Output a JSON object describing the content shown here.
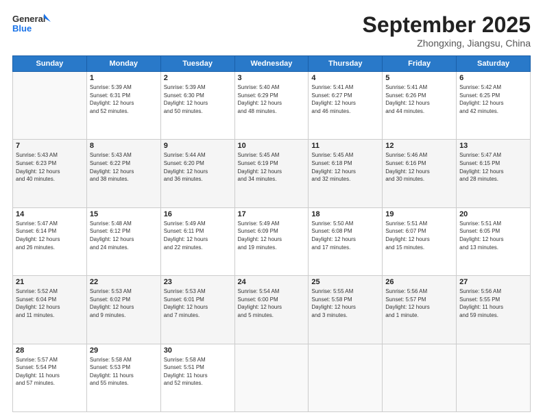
{
  "header": {
    "logo_line1": "General",
    "logo_line2": "Blue",
    "month": "September 2025",
    "location": "Zhongxing, Jiangsu, China"
  },
  "columns": [
    "Sunday",
    "Monday",
    "Tuesday",
    "Wednesday",
    "Thursday",
    "Friday",
    "Saturday"
  ],
  "weeks": [
    [
      {
        "day": "",
        "info": ""
      },
      {
        "day": "1",
        "info": "Sunrise: 5:39 AM\nSunset: 6:31 PM\nDaylight: 12 hours\nand 52 minutes."
      },
      {
        "day": "2",
        "info": "Sunrise: 5:39 AM\nSunset: 6:30 PM\nDaylight: 12 hours\nand 50 minutes."
      },
      {
        "day": "3",
        "info": "Sunrise: 5:40 AM\nSunset: 6:29 PM\nDaylight: 12 hours\nand 48 minutes."
      },
      {
        "day": "4",
        "info": "Sunrise: 5:41 AM\nSunset: 6:27 PM\nDaylight: 12 hours\nand 46 minutes."
      },
      {
        "day": "5",
        "info": "Sunrise: 5:41 AM\nSunset: 6:26 PM\nDaylight: 12 hours\nand 44 minutes."
      },
      {
        "day": "6",
        "info": "Sunrise: 5:42 AM\nSunset: 6:25 PM\nDaylight: 12 hours\nand 42 minutes."
      }
    ],
    [
      {
        "day": "7",
        "info": "Sunrise: 5:43 AM\nSunset: 6:23 PM\nDaylight: 12 hours\nand 40 minutes."
      },
      {
        "day": "8",
        "info": "Sunrise: 5:43 AM\nSunset: 6:22 PM\nDaylight: 12 hours\nand 38 minutes."
      },
      {
        "day": "9",
        "info": "Sunrise: 5:44 AM\nSunset: 6:20 PM\nDaylight: 12 hours\nand 36 minutes."
      },
      {
        "day": "10",
        "info": "Sunrise: 5:45 AM\nSunset: 6:19 PM\nDaylight: 12 hours\nand 34 minutes."
      },
      {
        "day": "11",
        "info": "Sunrise: 5:45 AM\nSunset: 6:18 PM\nDaylight: 12 hours\nand 32 minutes."
      },
      {
        "day": "12",
        "info": "Sunrise: 5:46 AM\nSunset: 6:16 PM\nDaylight: 12 hours\nand 30 minutes."
      },
      {
        "day": "13",
        "info": "Sunrise: 5:47 AM\nSunset: 6:15 PM\nDaylight: 12 hours\nand 28 minutes."
      }
    ],
    [
      {
        "day": "14",
        "info": "Sunrise: 5:47 AM\nSunset: 6:14 PM\nDaylight: 12 hours\nand 26 minutes."
      },
      {
        "day": "15",
        "info": "Sunrise: 5:48 AM\nSunset: 6:12 PM\nDaylight: 12 hours\nand 24 minutes."
      },
      {
        "day": "16",
        "info": "Sunrise: 5:49 AM\nSunset: 6:11 PM\nDaylight: 12 hours\nand 22 minutes."
      },
      {
        "day": "17",
        "info": "Sunrise: 5:49 AM\nSunset: 6:09 PM\nDaylight: 12 hours\nand 19 minutes."
      },
      {
        "day": "18",
        "info": "Sunrise: 5:50 AM\nSunset: 6:08 PM\nDaylight: 12 hours\nand 17 minutes."
      },
      {
        "day": "19",
        "info": "Sunrise: 5:51 AM\nSunset: 6:07 PM\nDaylight: 12 hours\nand 15 minutes."
      },
      {
        "day": "20",
        "info": "Sunrise: 5:51 AM\nSunset: 6:05 PM\nDaylight: 12 hours\nand 13 minutes."
      }
    ],
    [
      {
        "day": "21",
        "info": "Sunrise: 5:52 AM\nSunset: 6:04 PM\nDaylight: 12 hours\nand 11 minutes."
      },
      {
        "day": "22",
        "info": "Sunrise: 5:53 AM\nSunset: 6:02 PM\nDaylight: 12 hours\nand 9 minutes."
      },
      {
        "day": "23",
        "info": "Sunrise: 5:53 AM\nSunset: 6:01 PM\nDaylight: 12 hours\nand 7 minutes."
      },
      {
        "day": "24",
        "info": "Sunrise: 5:54 AM\nSunset: 6:00 PM\nDaylight: 12 hours\nand 5 minutes."
      },
      {
        "day": "25",
        "info": "Sunrise: 5:55 AM\nSunset: 5:58 PM\nDaylight: 12 hours\nand 3 minutes."
      },
      {
        "day": "26",
        "info": "Sunrise: 5:56 AM\nSunset: 5:57 PM\nDaylight: 12 hours\nand 1 minute."
      },
      {
        "day": "27",
        "info": "Sunrise: 5:56 AM\nSunset: 5:55 PM\nDaylight: 11 hours\nand 59 minutes."
      }
    ],
    [
      {
        "day": "28",
        "info": "Sunrise: 5:57 AM\nSunset: 5:54 PM\nDaylight: 11 hours\nand 57 minutes."
      },
      {
        "day": "29",
        "info": "Sunrise: 5:58 AM\nSunset: 5:53 PM\nDaylight: 11 hours\nand 55 minutes."
      },
      {
        "day": "30",
        "info": "Sunrise: 5:58 AM\nSunset: 5:51 PM\nDaylight: 11 hours\nand 52 minutes."
      },
      {
        "day": "",
        "info": ""
      },
      {
        "day": "",
        "info": ""
      },
      {
        "day": "",
        "info": ""
      },
      {
        "day": "",
        "info": ""
      }
    ]
  ]
}
